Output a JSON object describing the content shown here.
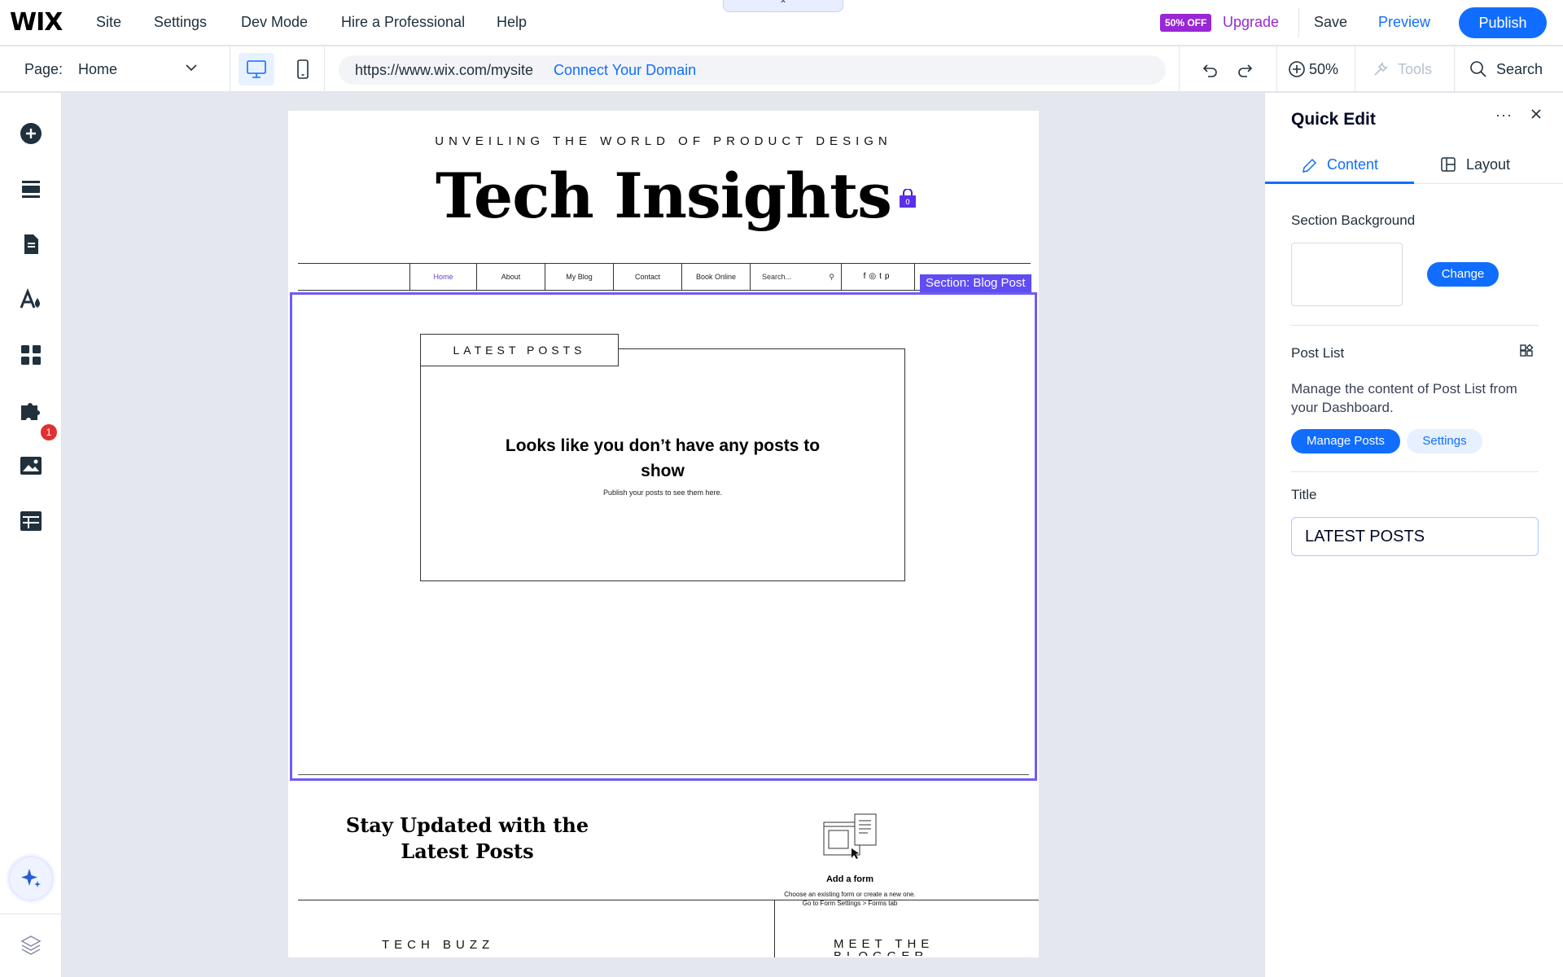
{
  "topbar": {
    "logo": "WIX",
    "menu": [
      "Site",
      "Settings",
      "Dev Mode",
      "Hire a Professional",
      "Help"
    ],
    "discount_badge": "50% OFF",
    "upgrade": "Upgrade",
    "save": "Save",
    "preview": "Preview",
    "publish": "Publish"
  },
  "secbar": {
    "page_label": "Page:",
    "page_name": "Home",
    "url": "https://www.wix.com/mysite",
    "connect_domain": "Connect Your Domain",
    "zoom": "50%",
    "tools": "Tools",
    "search": "Search"
  },
  "left_toolbar": {
    "icons": [
      "add-icon",
      "sections-icon",
      "pages-icon",
      "design-icon",
      "apps-icon",
      "business-icon",
      "media-icon",
      "cms-icon"
    ],
    "apps_notification": "1"
  },
  "site": {
    "tagline": "UNVEILING THE WORLD OF PRODUCT DESIGN",
    "title": "Tech Insights",
    "cart_count": "0",
    "nav": [
      "Home",
      "About",
      "My Blog",
      "Contact",
      "Book Online"
    ],
    "search_placeholder": "Search...",
    "social": [
      "f",
      "◎",
      "t",
      "p"
    ],
    "section_label": "Section: Blog Post",
    "latest_posts": "LATEST POSTS",
    "empty_heading": "Looks like you don’t have any posts to show",
    "empty_sub": "Publish your posts to see them here.",
    "stay_updated": "Stay Updated with the Latest Posts",
    "add_form": "Add a form",
    "add_form_sub1": "Choose an existing form or create a new one.",
    "add_form_sub2": "Go to Form Settings > Forms tab",
    "tech_buzz": "TECH BUZZ",
    "meet_blogger": "MEET THE BLOGGER"
  },
  "quick_edit": {
    "title": "Quick Edit",
    "tabs": [
      "Content",
      "Layout"
    ],
    "section_background": "Section Background",
    "change": "Change",
    "post_list": "Post List",
    "post_list_desc": "Manage the content of Post List from your Dashboard.",
    "manage_posts": "Manage Posts",
    "settings": "Settings",
    "title_label": "Title",
    "title_value": "LATEST POSTS"
  },
  "colors": {
    "accent": "#116dff",
    "upgrade": "#9a27d5",
    "selection": "#6e5cf6",
    "notification": "#df3131"
  }
}
